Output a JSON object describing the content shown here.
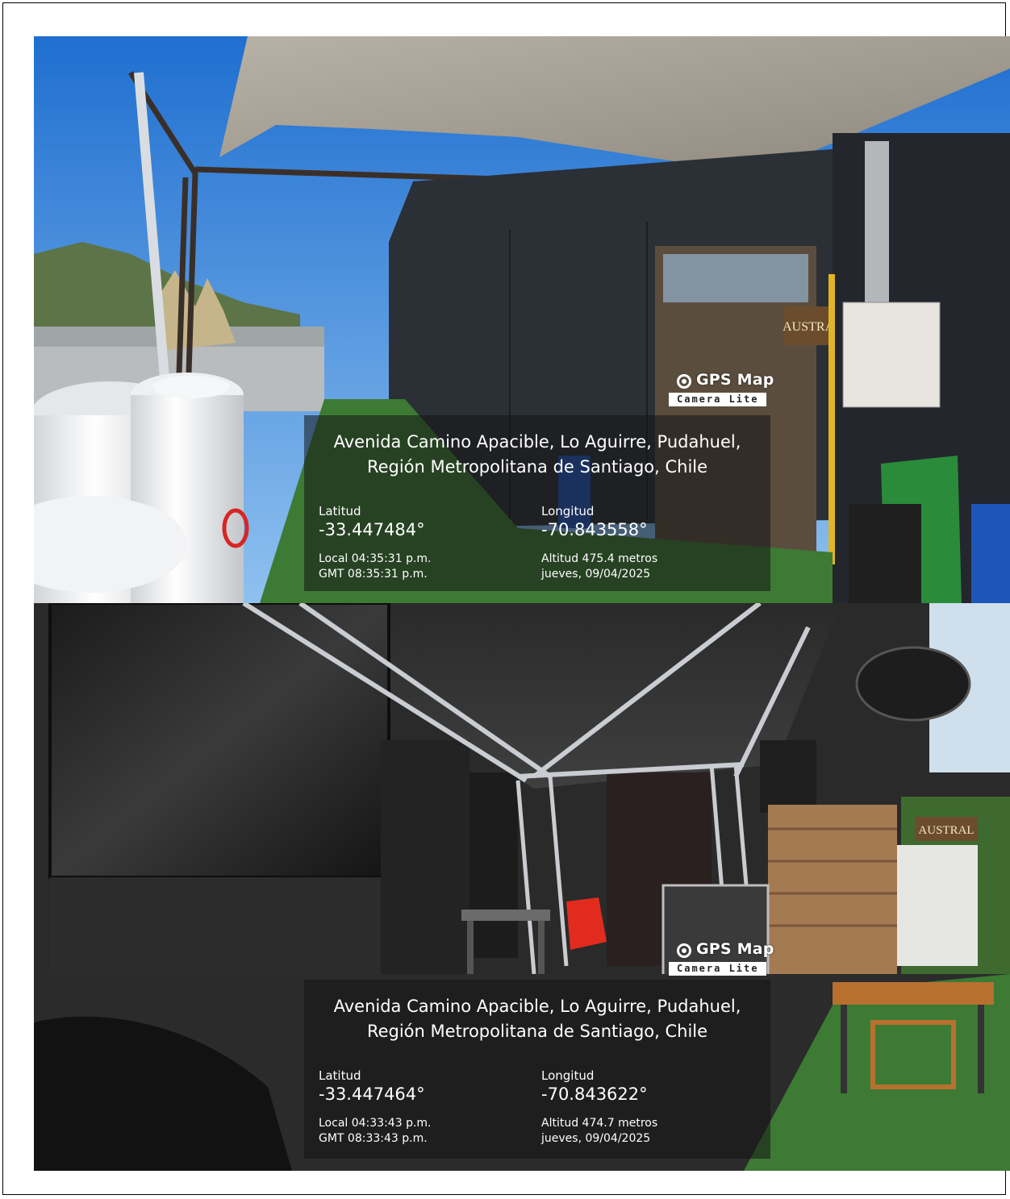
{
  "photos": [
    {
      "scene": "outdoor terrace exterior with gas tanks and black wall",
      "logo": {
        "main": "GPS Map",
        "sub": "Camera Lite"
      },
      "address_line1": "Avenida Camino Apacible, Lo Aguirre, Pudahuel,",
      "address_line2": "Región Metropolitana de Santiago, Chile",
      "lat_label": "Latitud",
      "lat_value": "-33.447484°",
      "lon_label": "Longitud",
      "lon_value": "-70.843558°",
      "local_time": "Local 04:35:31 p.m.",
      "gmt_time": "GMT 08:35:31 p.m.",
      "altitude": "Altitud  475.4 metros",
      "date": "jueves, 09/04/2025",
      "signage": {
        "brand": "AUSTRAL"
      }
    },
    {
      "scene": "stage with metal truss, screens and tables",
      "logo": {
        "main": "GPS Map",
        "sub": "Camera Lite"
      },
      "address_line1": "Avenida Camino Apacible, Lo Aguirre, Pudahuel,",
      "address_line2": "Región Metropolitana de Santiago, Chile",
      "lat_label": "Latitud",
      "lat_value": "-33.447464°",
      "lon_label": "Longitud",
      "lon_value": "-70.843622°",
      "local_time": "Local 04:33:43 p.m.",
      "gmt_time": "GMT 08:33:43 p.m.",
      "altitude": "Altitud  474.7 metros",
      "date": "jueves, 09/04/2025",
      "signage": {
        "brand": "AUSTRAL"
      }
    }
  ],
  "colors": {
    "sky": "#3a86d8",
    "wall": "#2b2f36",
    "grass": "#3d7a34",
    "stamp_bg": "#141414",
    "truss": "#c9ccd1"
  }
}
